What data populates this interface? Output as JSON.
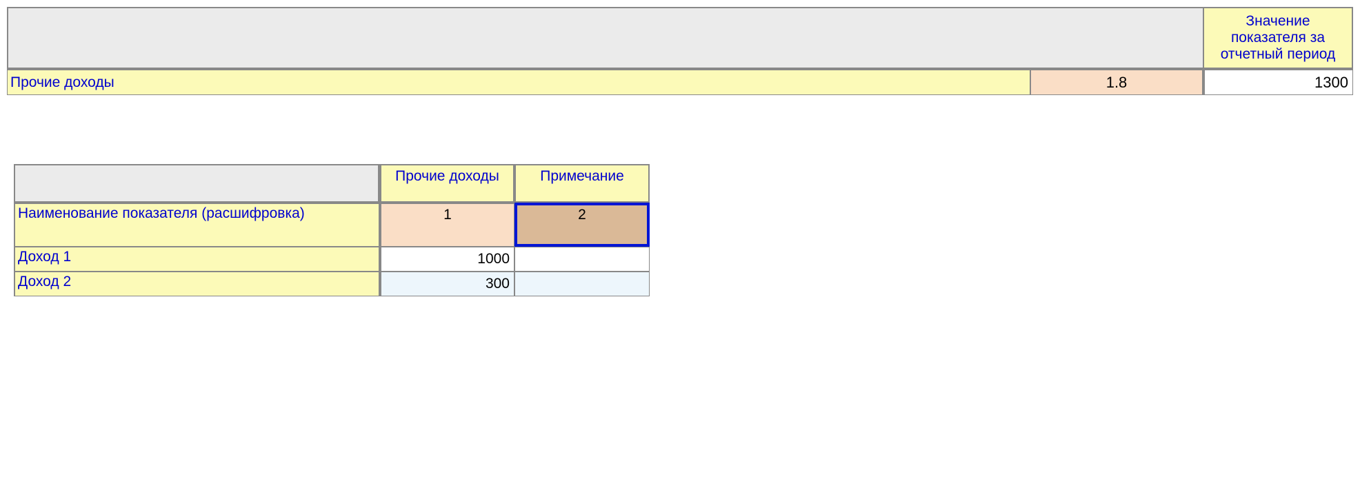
{
  "table1": {
    "header_right": "Значение показателя за отчетный период",
    "row_label": "Прочие доходы",
    "row_mid": "1.8",
    "row_right": "1300"
  },
  "table2": {
    "col1_header": "Прочие доходы",
    "col2_header": "Примечание",
    "row_header_main": "Наименование показателя (расшифровка)",
    "num1": "1",
    "num2": "2",
    "rows": [
      {
        "label": "Доход 1",
        "v1": "1000",
        "v2": ""
      },
      {
        "label": "Доход 2",
        "v1": "300",
        "v2": ""
      }
    ]
  }
}
